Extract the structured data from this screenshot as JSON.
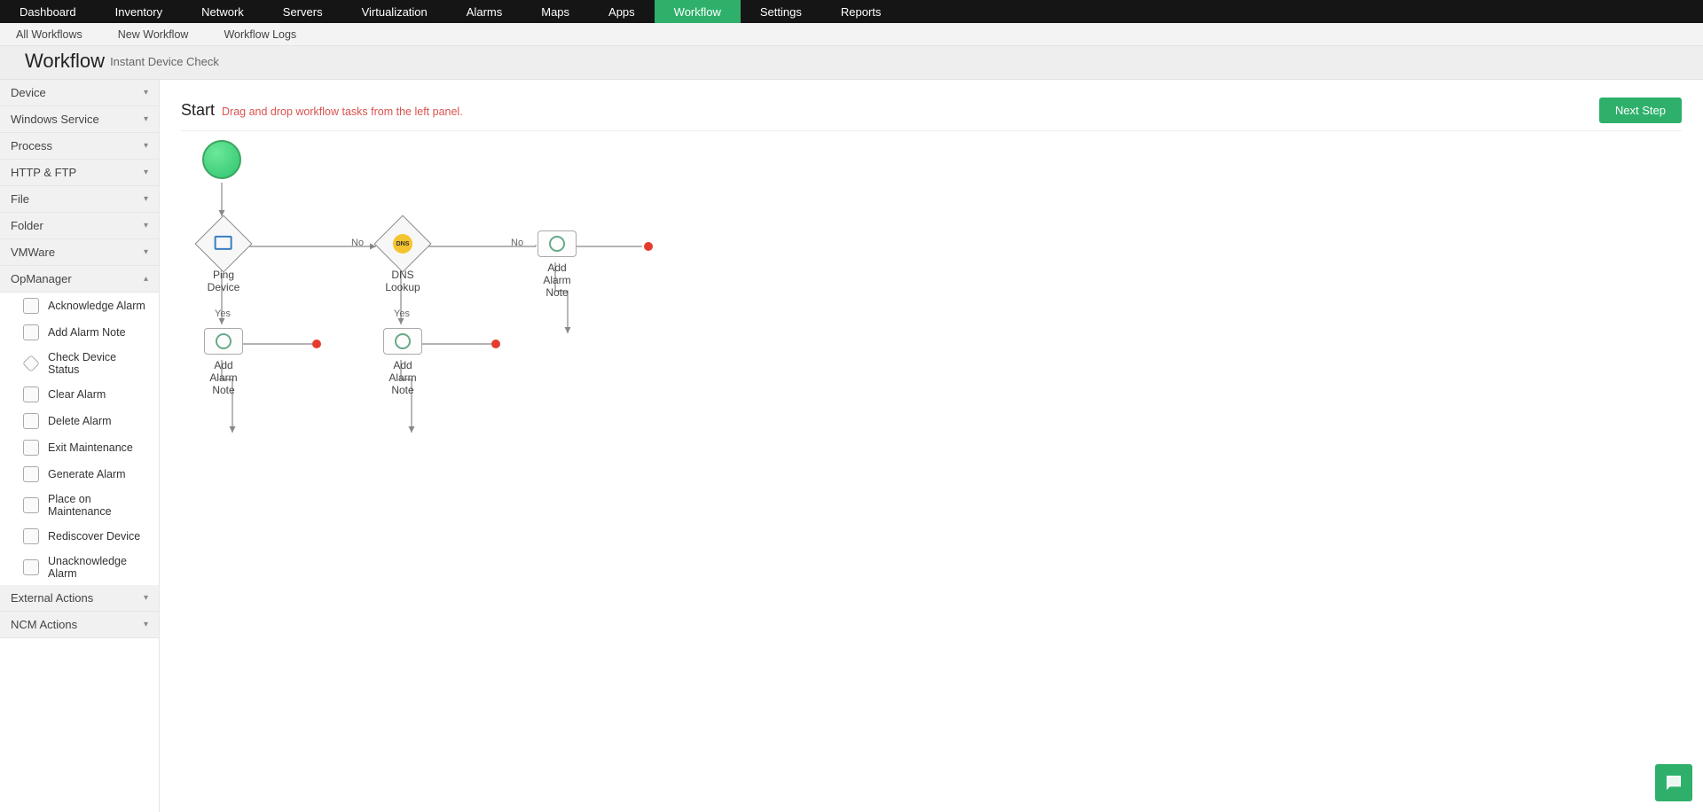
{
  "topnav": [
    {
      "label": "Dashboard"
    },
    {
      "label": "Inventory"
    },
    {
      "label": "Network"
    },
    {
      "label": "Servers"
    },
    {
      "label": "Virtualization"
    },
    {
      "label": "Alarms"
    },
    {
      "label": "Maps"
    },
    {
      "label": "Apps"
    },
    {
      "label": "Workflow",
      "active": true
    },
    {
      "label": "Settings"
    },
    {
      "label": "Reports"
    }
  ],
  "subnav": {
    "all": "All Workflows",
    "new": "New Workflow",
    "logs": "Workflow Logs"
  },
  "title": {
    "big": "Workflow",
    "sub": "Instant Device Check"
  },
  "header": {
    "start": "Start",
    "hint": "Drag and drop workflow tasks from the left panel.",
    "next": "Next Step"
  },
  "sidebar": {
    "groups": [
      {
        "label": "Device"
      },
      {
        "label": "Windows Service"
      },
      {
        "label": "Process"
      },
      {
        "label": "HTTP & FTP"
      },
      {
        "label": "File"
      },
      {
        "label": "Folder"
      },
      {
        "label": "VMWare"
      }
    ],
    "opmanager": {
      "label": "OpManager",
      "items": [
        {
          "label": "Acknowledge Alarm",
          "shape": "rect"
        },
        {
          "label": "Add Alarm Note",
          "shape": "rect"
        },
        {
          "label": "Check Device Status",
          "shape": "diamond"
        },
        {
          "label": "Clear Alarm",
          "shape": "rect"
        },
        {
          "label": "Delete Alarm",
          "shape": "rect"
        },
        {
          "label": "Exit Maintenance",
          "shape": "rect"
        },
        {
          "label": "Generate Alarm",
          "shape": "rect"
        },
        {
          "label": "Place on Maintenance",
          "shape": "rect"
        },
        {
          "label": "Rediscover Device",
          "shape": "rect"
        },
        {
          "label": "Unacknowledge Alarm",
          "shape": "rect"
        }
      ]
    },
    "tail": [
      {
        "label": "External Actions"
      },
      {
        "label": "NCM Actions"
      }
    ]
  },
  "canvas": {
    "labels": {
      "ping": "Ping\nDevice",
      "dns": "DNS\nLookup",
      "addnote": "Add\nAlarm\nNote",
      "yes": "Yes",
      "no": "No"
    },
    "icons": {
      "dns_text": "DNS"
    }
  }
}
